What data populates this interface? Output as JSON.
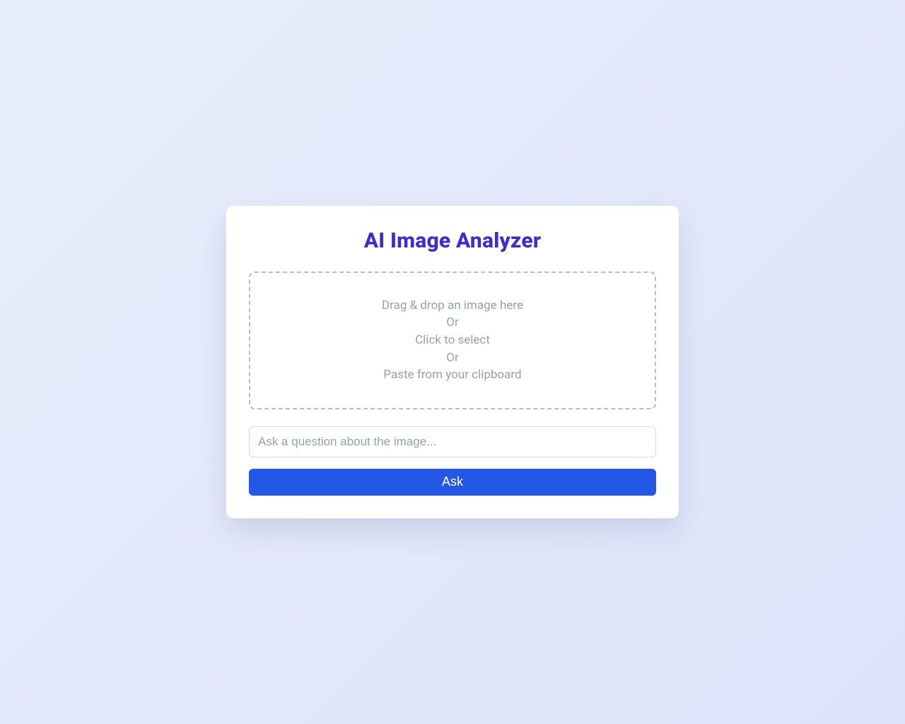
{
  "card": {
    "title": "AI Image Analyzer",
    "dropzone": {
      "line1": "Drag & drop an image here",
      "line2": "Or",
      "line3": "Click to select",
      "line4": "Or",
      "line5": "Paste from your clipboard"
    },
    "input": {
      "placeholder": "Ask a question about the image...",
      "value": ""
    },
    "ask_button_label": "Ask"
  }
}
